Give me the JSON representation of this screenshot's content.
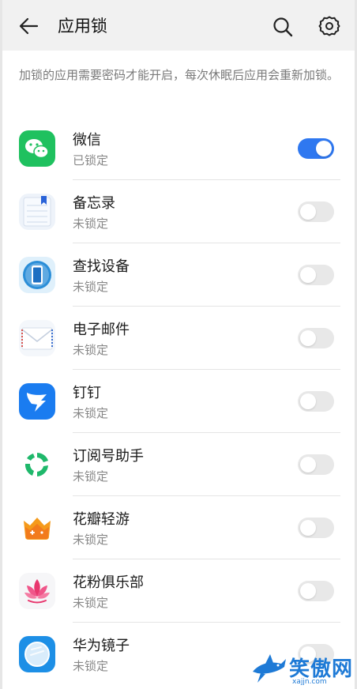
{
  "header": {
    "title": "应用锁",
    "back_icon": "arrow-left-icon",
    "search_icon": "search-icon",
    "settings_icon": "gear-icon"
  },
  "description": "加锁的应用需要密码才能开启，每次休眠后应用会重新加锁。",
  "apps": [
    {
      "name": "微信",
      "status": "已锁定",
      "locked": true,
      "icon": "wechat-icon"
    },
    {
      "name": "备忘录",
      "status": "未锁定",
      "locked": false,
      "icon": "notes-icon"
    },
    {
      "name": "查找设备",
      "status": "未锁定",
      "locked": false,
      "icon": "find-device-icon"
    },
    {
      "name": "电子邮件",
      "status": "未锁定",
      "locked": false,
      "icon": "email-icon"
    },
    {
      "name": "钉钉",
      "status": "未锁定",
      "locked": false,
      "icon": "dingtalk-icon"
    },
    {
      "name": "订阅号助手",
      "status": "未锁定",
      "locked": false,
      "icon": "subscription-assistant-icon"
    },
    {
      "name": "花瓣轻游",
      "status": "未锁定",
      "locked": false,
      "icon": "petal-games-icon"
    },
    {
      "name": "花粉俱乐部",
      "status": "未锁定",
      "locked": false,
      "icon": "huafen-club-icon"
    },
    {
      "name": "华为镜子",
      "status": "未锁定",
      "locked": false,
      "icon": "mirror-icon"
    }
  ],
  "watermark": {
    "text": "笑傲网",
    "sub": "xajjn.com"
  },
  "colors": {
    "accent": "#2f78f0",
    "toggle_off": "#e8e8e8",
    "header_bg": "#f1f1f1"
  }
}
